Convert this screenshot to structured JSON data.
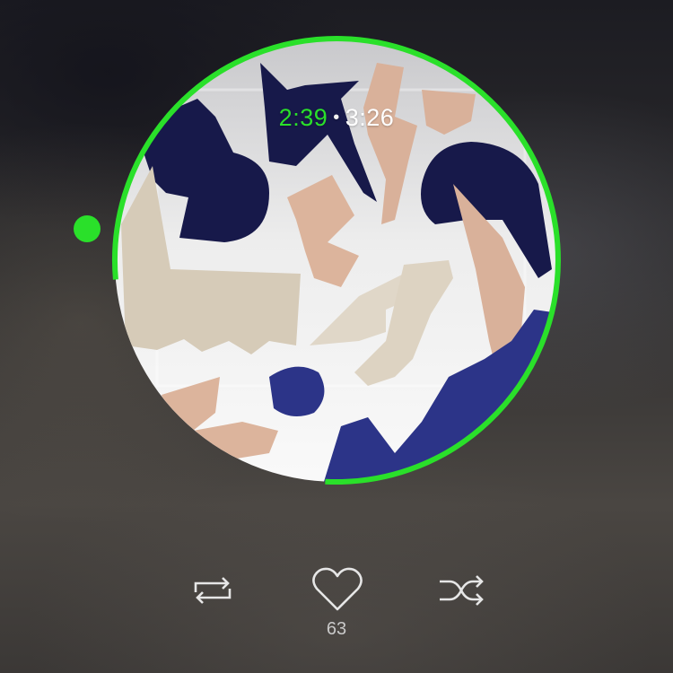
{
  "player": {
    "elapsed_time": "2:39",
    "separator": "•",
    "total_time": "3:26",
    "progress_fraction": 0.772,
    "accent_color": "#2ae02a"
  },
  "artwork": {
    "icon": "abstract-cutout-album-art"
  },
  "controls": {
    "repeat_icon": "repeat-icon",
    "like_icon": "heart-icon",
    "shuffle_icon": "shuffle-icon",
    "like_count": "63"
  }
}
